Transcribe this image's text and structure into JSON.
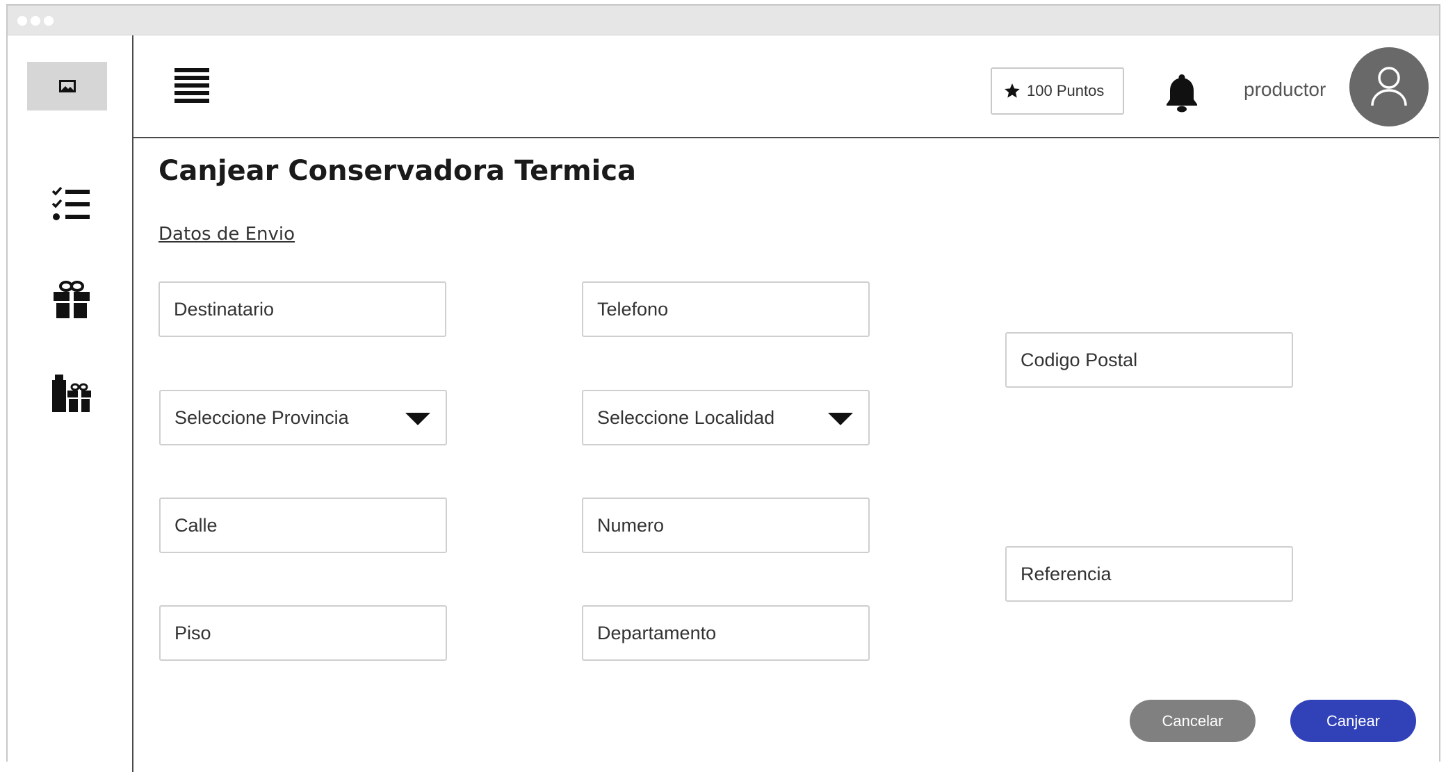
{
  "header": {
    "points_label": "100 Puntos",
    "username": "productor"
  },
  "page": {
    "title": "Canjear Conservadora Termica",
    "section_link": "Datos de Envio"
  },
  "form": {
    "destinatario_placeholder": "Destinatario",
    "telefono_placeholder": "Telefono",
    "codigo_postal_placeholder": "Codigo Postal",
    "provincia_selected": "Seleccione Provincia",
    "localidad_selected": "Seleccione Localidad",
    "calle_placeholder": "Calle",
    "numero_placeholder": "Numero",
    "referencia_placeholder": "Referencia",
    "piso_placeholder": "Piso",
    "departamento_placeholder": "Departamento"
  },
  "actions": {
    "cancel_label": "Cancelar",
    "submit_label": "Canjear"
  },
  "icons": {
    "logo": "image-icon",
    "menu": "hamburger-menu-icon",
    "points": "star-icon",
    "notifications": "bell-icon",
    "avatar": "user-icon",
    "nav": [
      "checklist-icon",
      "gift-icon",
      "gifts-icon"
    ]
  },
  "colors": {
    "primary_button": "#3142b8",
    "secondary_button": "#808080",
    "avatar_bg": "#696969"
  }
}
